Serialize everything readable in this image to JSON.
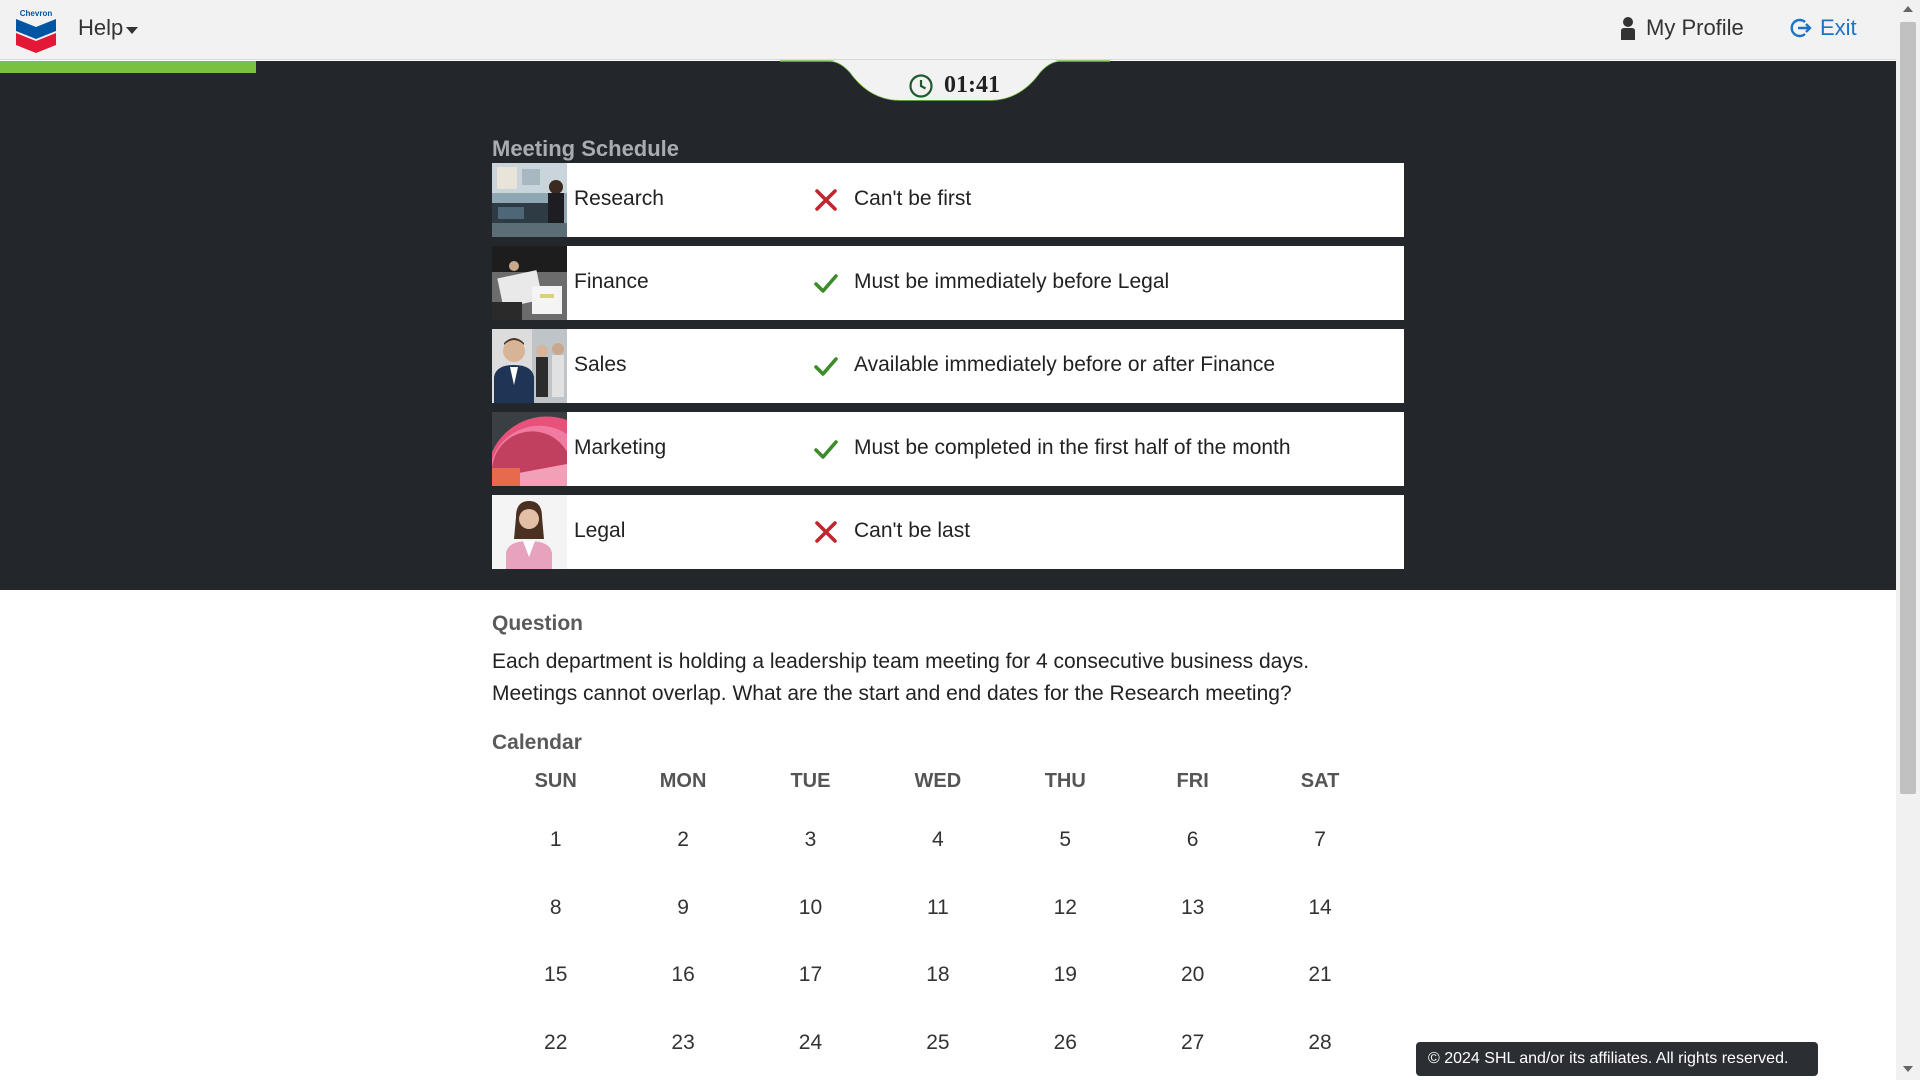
{
  "header": {
    "logo_text": "Chevron",
    "help_label": "Help",
    "profile_label": "My Profile",
    "exit_label": "Exit"
  },
  "progress": {
    "fraction": 0.135
  },
  "timer": {
    "value": "01:41"
  },
  "schedule": {
    "title": "Meeting Schedule",
    "rows": [
      {
        "dept": "Research",
        "status": "cross",
        "rule": "Can't be first"
      },
      {
        "dept": "Finance",
        "status": "check",
        "rule": "Must be immediately before Legal"
      },
      {
        "dept": "Sales",
        "status": "check",
        "rule": "Available immediately before or after Finance"
      },
      {
        "dept": "Marketing",
        "status": "check",
        "rule": "Must be completed in the first half of the month"
      },
      {
        "dept": "Legal",
        "status": "cross",
        "rule": "Can't be last"
      }
    ]
  },
  "question": {
    "label": "Question",
    "line1": "Each department is holding a leadership team meeting for 4 consecutive business days.",
    "line2": "Meetings cannot overlap. What are the start and end dates for the Research meeting?"
  },
  "calendar": {
    "label": "Calendar",
    "days": [
      "SUN",
      "MON",
      "TUE",
      "WED",
      "THU",
      "FRI",
      "SAT"
    ],
    "dates": [
      "1",
      "2",
      "3",
      "4",
      "5",
      "6",
      "7",
      "8",
      "9",
      "10",
      "11",
      "12",
      "13",
      "14",
      "15",
      "16",
      "17",
      "18",
      "19",
      "20",
      "21",
      "22",
      "23",
      "24",
      "25",
      "26",
      "27",
      "28"
    ]
  },
  "footer": {
    "copyright": "© 2024 SHL and/or its affiliates. All rights reserved."
  },
  "colors": {
    "accent_green": "#7ac142",
    "dark_panel": "#23272b",
    "exit_blue": "#1a73c8",
    "cross_red": "#c0262d",
    "check_green": "#3d8b2a"
  }
}
